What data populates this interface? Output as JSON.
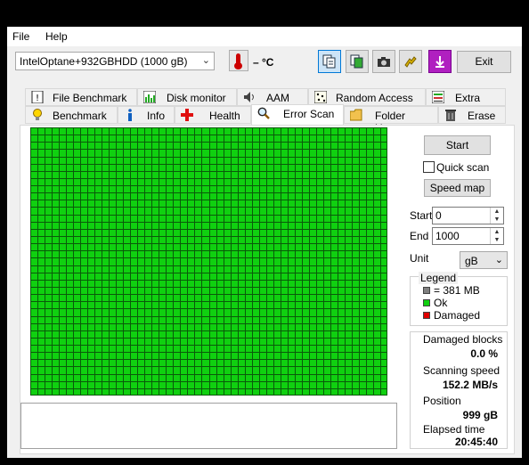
{
  "menu": {
    "file": "File",
    "help": "Help"
  },
  "drive": {
    "selected": "IntelOptane+932GBHDD (1000 gB)"
  },
  "temperature": {
    "value": "– °C"
  },
  "toolbar": {
    "exit_label": "Exit",
    "icons": [
      "copy-text-icon",
      "copy-image-icon",
      "camera-icon",
      "options-icon",
      "save-down-icon"
    ]
  },
  "tabs": {
    "row1": [
      "File Benchmark",
      "Disk monitor",
      "AAM",
      "Random Access",
      "Extra tests"
    ],
    "row2": [
      "Benchmark",
      "Info",
      "Health",
      "Error Scan",
      "Folder Usage",
      "Erase"
    ],
    "selected": "Error Scan"
  },
  "scan": {
    "start_button": "Start",
    "quick_scan_label": "Quick scan",
    "quick_scan_checked": false,
    "speed_map_button": "Speed map",
    "start_label": "Start",
    "start_value": "0",
    "end_label": "End",
    "end_value": "1000",
    "unit_label": "Unit",
    "unit_value": "gB"
  },
  "legend": {
    "title": "Legend",
    "block_size": "= 381 MB",
    "ok": "Ok",
    "damaged": "Damaged",
    "colors": {
      "block": "#808080",
      "ok": "#10d010",
      "damaged": "#e00000"
    }
  },
  "stats": {
    "damaged_blocks_label": "Damaged blocks",
    "damaged_blocks_value": "0.0 %",
    "scanning_speed_label": "Scanning speed",
    "scanning_speed_value": "152.2 MB/s",
    "position_label": "Position",
    "position_value": "999 gB",
    "elapsed_label": "Elapsed time",
    "elapsed_value": "20:45:40"
  },
  "block_map": {
    "cols": 50,
    "rows": 37,
    "status": "ok",
    "color": "#10d010"
  }
}
